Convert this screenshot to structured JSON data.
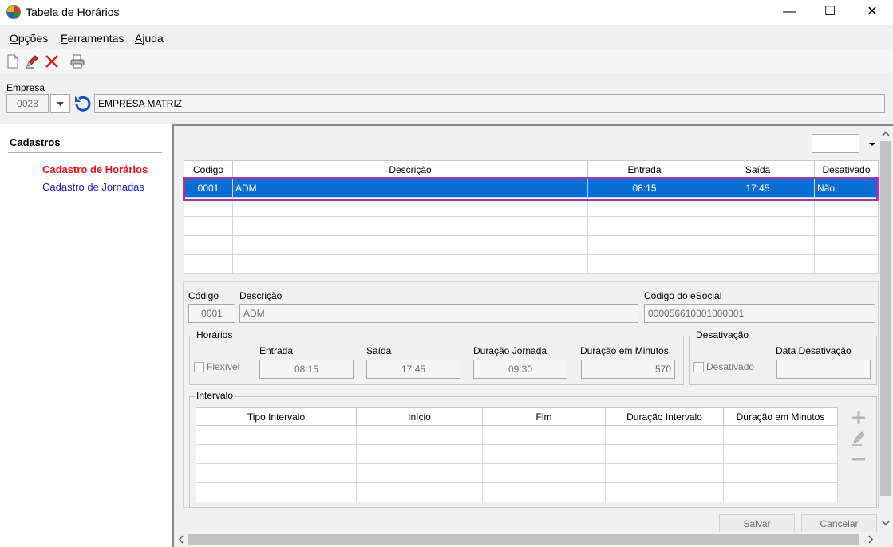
{
  "window": {
    "title": "Tabela de Horários",
    "minimize_glyph": "—",
    "maximize_glyph": "☐",
    "close_glyph": "✕"
  },
  "menu": {
    "opcoes": {
      "u": "O",
      "rest": "pções"
    },
    "ferramentas": {
      "u": "F",
      "rest": "erramentas"
    },
    "ajuda": {
      "u": "A",
      "rest": "juda"
    }
  },
  "toolbar": {
    "icons": [
      "new-document-icon",
      "edit-pencil-icon",
      "delete-x-icon",
      "print-icon"
    ]
  },
  "empresa": {
    "label": "Empresa",
    "code": "0028",
    "name": "EMPRESA MATRIZ"
  },
  "sidebar": {
    "title": "Cadastros",
    "items": [
      "Cadastro de Horários",
      "Cadastro de Jornadas"
    ],
    "active_color": "#e8141b",
    "link_color": "#1a1acc"
  },
  "horarios_table": {
    "columns": [
      "Código",
      "Descrição",
      "Entrada",
      "Saída",
      "Desativado"
    ],
    "rows": [
      {
        "codigo": "0001",
        "descricao": "ADM",
        "entrada": "08:15",
        "saida": "17:45",
        "desativado": "Não"
      }
    ],
    "empty_rows": 4,
    "selection_color": "#0a6fd2",
    "highlight_border_color": "#9b3aa8"
  },
  "form": {
    "codigo_label": "Código",
    "codigo": "0001",
    "descricao_label": "Descrição",
    "descricao": "ADM",
    "esocial_label": "Código do eSocial",
    "esocial": "000056610001000001"
  },
  "horarios": {
    "title": "Horários",
    "flexivel_label": "Flexível",
    "entrada_label": "Entrada",
    "entrada": "08:15",
    "saida_label": "Saída",
    "saida": "17:45",
    "duracao_label": "Duração Jornada",
    "duracao": "09:30",
    "minutos_label": "Duração em Minutos",
    "minutos": "570"
  },
  "desativacao": {
    "title": "Desativação",
    "desativado_label": "Desativado",
    "data_label": "Data Desativação",
    "data": ""
  },
  "intervalo": {
    "title": "Intervalo",
    "columns": [
      "Tipo Intervalo",
      "Início",
      "Fim",
      "Duração Intervalo",
      "Duração em Minutos"
    ],
    "empty_rows": 4
  },
  "buttons": {
    "salvar": "Salvar",
    "cancelar": "Cancelar"
  }
}
